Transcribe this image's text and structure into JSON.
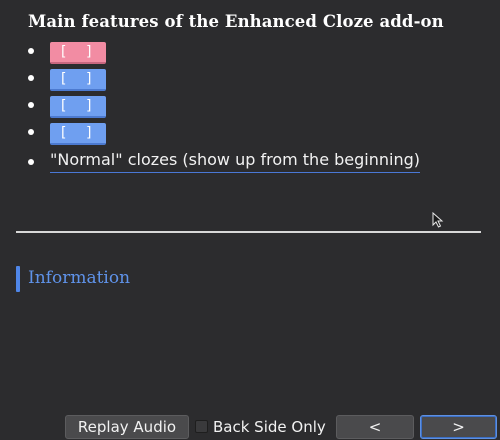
{
  "card": {
    "title": "Main features of the Enhanced Cloze add-on",
    "features": [
      {
        "type": "cloze",
        "color": "#f28ca3",
        "bracket_open": "[",
        "bracket_close": "]"
      },
      {
        "type": "cloze",
        "color": "#6f9ff0",
        "bracket_open": "[",
        "bracket_close": "]"
      },
      {
        "type": "cloze",
        "color": "#6f9ff0",
        "bracket_open": "[",
        "bracket_close": "]"
      },
      {
        "type": "cloze",
        "color": "#6f9ff0",
        "bracket_open": "[",
        "bracket_close": "]"
      },
      {
        "type": "text",
        "text": "\"Normal\" clozes (show up from the beginning)"
      }
    ],
    "info_heading": "Information"
  },
  "toolbar": {
    "replay_label": "Replay Audio",
    "back_side_only_label": "Back Side Only",
    "back_side_only_checked": false,
    "prev_label": "<",
    "next_label": ">"
  },
  "colors": {
    "background": "#2c2c2e",
    "accent": "#4f86e8",
    "cloze_pink": "#f28ca3",
    "cloze_blue": "#6f9ff0"
  }
}
